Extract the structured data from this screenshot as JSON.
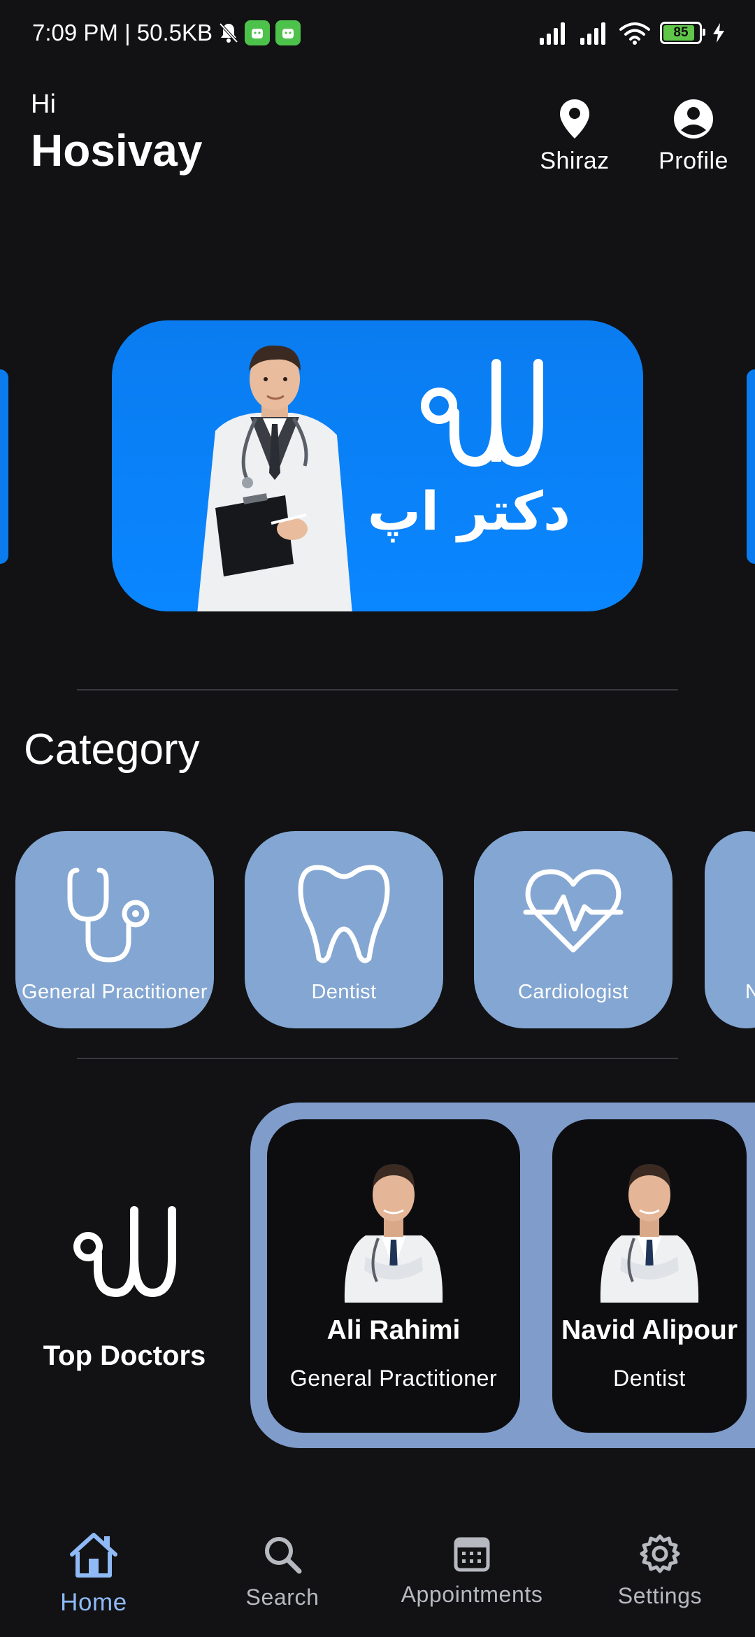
{
  "status_bar": {
    "time_info": "7:09 PM | 50.5KB",
    "battery": "85"
  },
  "header": {
    "greeting": "Hi",
    "user_name": "Hosivay",
    "location_label": "Shiraz",
    "profile_label": "Profile"
  },
  "banner": {
    "persian_text": "دکتر اپ"
  },
  "categories": {
    "title": "Category",
    "items": [
      {
        "label": "General Practitioner",
        "icon": "stethoscope-icon"
      },
      {
        "label": "Dentist",
        "icon": "tooth-icon"
      },
      {
        "label": "Cardiologist",
        "icon": "heart-pulse-icon"
      },
      {
        "label": "N",
        "icon": ""
      }
    ]
  },
  "top_doctors": {
    "title": "Top Doctors",
    "doctors": [
      {
        "name": "Ali Rahimi",
        "specialty": "General Practitioner"
      },
      {
        "name": "Navid Alipour",
        "specialty": "Dentist"
      }
    ]
  },
  "bottom_nav": {
    "items": [
      {
        "label": "Home",
        "icon": "home-icon",
        "active": true
      },
      {
        "label": "Search",
        "icon": "search-icon",
        "active": false
      },
      {
        "label": "Appointments",
        "icon": "calendar-icon",
        "active": false
      },
      {
        "label": "Settings",
        "icon": "gear-icon",
        "active": false
      }
    ]
  },
  "colors": {
    "background": "#121214",
    "banner_blue": "#0a7cf0",
    "category_card": "#84a6d2",
    "top_doctors_panel": "#7f9ccb",
    "nav_active": "#8fbaf6"
  }
}
